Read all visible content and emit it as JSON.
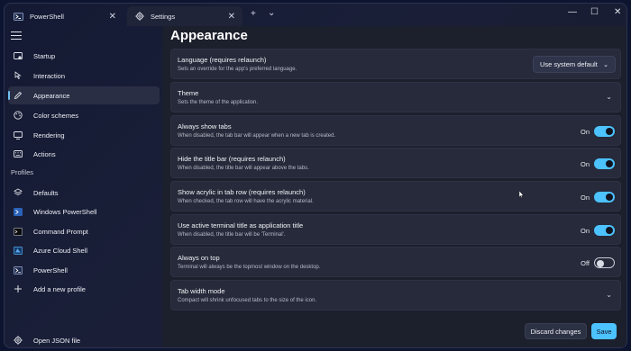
{
  "tabs": [
    {
      "label": "PowerShell",
      "icon": "powershell-icon"
    },
    {
      "label": "Settings",
      "icon": "gear-icon"
    }
  ],
  "tabbar": {
    "new_tab": "+",
    "dropdown": "⌄"
  },
  "window_controls": {
    "minimize": "—",
    "maximize": "☐",
    "close": "✕"
  },
  "sidebar": {
    "items": [
      {
        "label": "Startup",
        "icon": "startup-icon"
      },
      {
        "label": "Interaction",
        "icon": "interaction-icon"
      },
      {
        "label": "Appearance",
        "icon": "appearance-icon",
        "selected": true
      },
      {
        "label": "Color schemes",
        "icon": "palette-icon"
      },
      {
        "label": "Rendering",
        "icon": "monitor-icon"
      },
      {
        "label": "Actions",
        "icon": "keyboard-icon"
      }
    ],
    "profiles_header": "Profiles",
    "profiles": [
      {
        "label": "Defaults",
        "icon": "layers-icon"
      },
      {
        "label": "Windows PowerShell",
        "icon": "powershell-icon"
      },
      {
        "label": "Command Prompt",
        "icon": "cmd-icon"
      },
      {
        "label": "Azure Cloud Shell",
        "icon": "azure-icon"
      },
      {
        "label": "PowerShell",
        "icon": "powershell-icon"
      },
      {
        "label": "Add a new profile",
        "icon": "plus-icon"
      }
    ],
    "open_json": {
      "label": "Open JSON file",
      "icon": "gear-icon"
    }
  },
  "page": {
    "title": "Appearance"
  },
  "settings": [
    {
      "label": "Language (requires relaunch)",
      "desc": "Sets an override for the app's preferred language.",
      "control": "dropdown",
      "value": "Use system default"
    },
    {
      "label": "Theme",
      "desc": "Sets the theme of the application.",
      "control": "expander"
    },
    {
      "label": "Always show tabs",
      "desc": "When disabled, the tab bar will appear when a new tab is created.",
      "control": "toggle",
      "state": "On"
    },
    {
      "label": "Hide the title bar (requires relaunch)",
      "desc": "When disabled, the title bar will appear above the tabs.",
      "control": "toggle",
      "state": "On"
    },
    {
      "label": "Show acrylic in tab row (requires relaunch)",
      "desc": "When checked, the tab row will have the acrylic material.",
      "control": "toggle",
      "state": "On"
    },
    {
      "label": "Use active terminal title as application title",
      "desc": "When disabled, the title bar will be 'Terminal'.",
      "control": "toggle",
      "state": "On"
    },
    {
      "label": "Always on top",
      "desc": "Terminal will always be the topmost window on the desktop.",
      "control": "toggle",
      "state": "Off"
    },
    {
      "label": "Tab width mode",
      "desc": "Compact will shrink unfocused tabs to the size of the icon.",
      "control": "expander"
    }
  ],
  "footer": {
    "discard": "Discard changes",
    "save": "Save"
  },
  "colors": {
    "accent": "#4cc2ff",
    "background": "#1c1f2c",
    "card": "#262a3a"
  }
}
